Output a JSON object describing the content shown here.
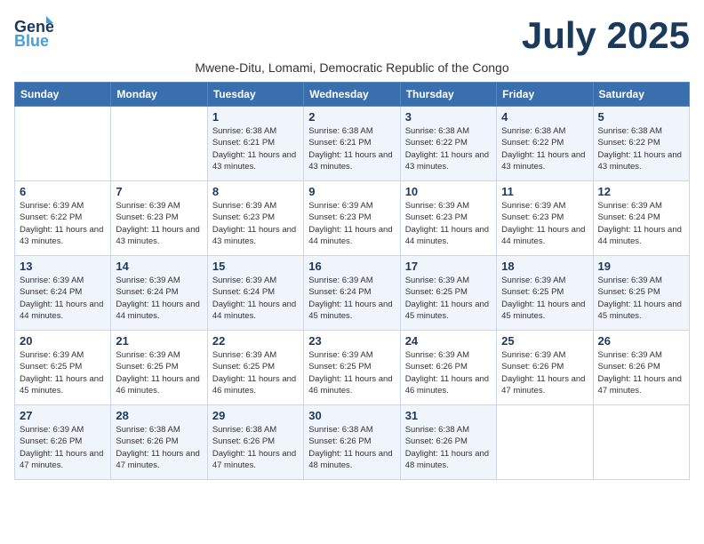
{
  "header": {
    "logo_line1": "General",
    "logo_line2": "Blue",
    "month_title": "July 2025",
    "subtitle": "Mwene-Ditu, Lomami, Democratic Republic of the Congo"
  },
  "days_of_week": [
    "Sunday",
    "Monday",
    "Tuesday",
    "Wednesday",
    "Thursday",
    "Friday",
    "Saturday"
  ],
  "weeks": [
    [
      {
        "day": "",
        "info": ""
      },
      {
        "day": "",
        "info": ""
      },
      {
        "day": "1",
        "info": "Sunrise: 6:38 AM\nSunset: 6:21 PM\nDaylight: 11 hours and 43 minutes."
      },
      {
        "day": "2",
        "info": "Sunrise: 6:38 AM\nSunset: 6:21 PM\nDaylight: 11 hours and 43 minutes."
      },
      {
        "day": "3",
        "info": "Sunrise: 6:38 AM\nSunset: 6:22 PM\nDaylight: 11 hours and 43 minutes."
      },
      {
        "day": "4",
        "info": "Sunrise: 6:38 AM\nSunset: 6:22 PM\nDaylight: 11 hours and 43 minutes."
      },
      {
        "day": "5",
        "info": "Sunrise: 6:38 AM\nSunset: 6:22 PM\nDaylight: 11 hours and 43 minutes."
      }
    ],
    [
      {
        "day": "6",
        "info": "Sunrise: 6:39 AM\nSunset: 6:22 PM\nDaylight: 11 hours and 43 minutes."
      },
      {
        "day": "7",
        "info": "Sunrise: 6:39 AM\nSunset: 6:23 PM\nDaylight: 11 hours and 43 minutes."
      },
      {
        "day": "8",
        "info": "Sunrise: 6:39 AM\nSunset: 6:23 PM\nDaylight: 11 hours and 43 minutes."
      },
      {
        "day": "9",
        "info": "Sunrise: 6:39 AM\nSunset: 6:23 PM\nDaylight: 11 hours and 44 minutes."
      },
      {
        "day": "10",
        "info": "Sunrise: 6:39 AM\nSunset: 6:23 PM\nDaylight: 11 hours and 44 minutes."
      },
      {
        "day": "11",
        "info": "Sunrise: 6:39 AM\nSunset: 6:23 PM\nDaylight: 11 hours and 44 minutes."
      },
      {
        "day": "12",
        "info": "Sunrise: 6:39 AM\nSunset: 6:24 PM\nDaylight: 11 hours and 44 minutes."
      }
    ],
    [
      {
        "day": "13",
        "info": "Sunrise: 6:39 AM\nSunset: 6:24 PM\nDaylight: 11 hours and 44 minutes."
      },
      {
        "day": "14",
        "info": "Sunrise: 6:39 AM\nSunset: 6:24 PM\nDaylight: 11 hours and 44 minutes."
      },
      {
        "day": "15",
        "info": "Sunrise: 6:39 AM\nSunset: 6:24 PM\nDaylight: 11 hours and 44 minutes."
      },
      {
        "day": "16",
        "info": "Sunrise: 6:39 AM\nSunset: 6:24 PM\nDaylight: 11 hours and 45 minutes."
      },
      {
        "day": "17",
        "info": "Sunrise: 6:39 AM\nSunset: 6:25 PM\nDaylight: 11 hours and 45 minutes."
      },
      {
        "day": "18",
        "info": "Sunrise: 6:39 AM\nSunset: 6:25 PM\nDaylight: 11 hours and 45 minutes."
      },
      {
        "day": "19",
        "info": "Sunrise: 6:39 AM\nSunset: 6:25 PM\nDaylight: 11 hours and 45 minutes."
      }
    ],
    [
      {
        "day": "20",
        "info": "Sunrise: 6:39 AM\nSunset: 6:25 PM\nDaylight: 11 hours and 45 minutes."
      },
      {
        "day": "21",
        "info": "Sunrise: 6:39 AM\nSunset: 6:25 PM\nDaylight: 11 hours and 46 minutes."
      },
      {
        "day": "22",
        "info": "Sunrise: 6:39 AM\nSunset: 6:25 PM\nDaylight: 11 hours and 46 minutes."
      },
      {
        "day": "23",
        "info": "Sunrise: 6:39 AM\nSunset: 6:25 PM\nDaylight: 11 hours and 46 minutes."
      },
      {
        "day": "24",
        "info": "Sunrise: 6:39 AM\nSunset: 6:26 PM\nDaylight: 11 hours and 46 minutes."
      },
      {
        "day": "25",
        "info": "Sunrise: 6:39 AM\nSunset: 6:26 PM\nDaylight: 11 hours and 47 minutes."
      },
      {
        "day": "26",
        "info": "Sunrise: 6:39 AM\nSunset: 6:26 PM\nDaylight: 11 hours and 47 minutes."
      }
    ],
    [
      {
        "day": "27",
        "info": "Sunrise: 6:39 AM\nSunset: 6:26 PM\nDaylight: 11 hours and 47 minutes."
      },
      {
        "day": "28",
        "info": "Sunrise: 6:38 AM\nSunset: 6:26 PM\nDaylight: 11 hours and 47 minutes."
      },
      {
        "day": "29",
        "info": "Sunrise: 6:38 AM\nSunset: 6:26 PM\nDaylight: 11 hours and 47 minutes."
      },
      {
        "day": "30",
        "info": "Sunrise: 6:38 AM\nSunset: 6:26 PM\nDaylight: 11 hours and 48 minutes."
      },
      {
        "day": "31",
        "info": "Sunrise: 6:38 AM\nSunset: 6:26 PM\nDaylight: 11 hours and 48 minutes."
      },
      {
        "day": "",
        "info": ""
      },
      {
        "day": "",
        "info": ""
      }
    ]
  ]
}
